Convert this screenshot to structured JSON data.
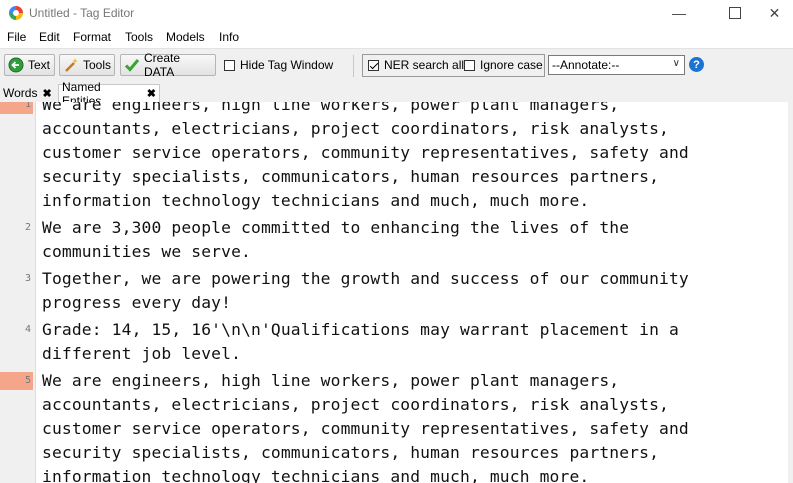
{
  "window": {
    "title": "Untitled - Tag Editor"
  },
  "menu": [
    "File",
    "Edit",
    "Format",
    "Tools",
    "Models",
    "Info"
  ],
  "toolbar": {
    "text_label": "Text",
    "tools_label": "Tools",
    "create_data_label": "Create DATA",
    "hide_tag_window_label": "Hide Tag Window",
    "ner_search_all_label": "NER search all",
    "ignore_case_label": "Ignore case",
    "annotate_value": "--Annotate:--",
    "help_label": "?"
  },
  "tabs": [
    {
      "label": "Words"
    },
    {
      "label": "Named Entities"
    }
  ],
  "lines": [
    {
      "number": "1",
      "highlight": true,
      "rows": [
        "We are engineers, high line workers, power plant managers,",
        "accountants, electricians, project coordinators, risk analysts,",
        "customer service operators, community representatives, safety and",
        "security specialists, communicators, human resources partners,",
        "information technology technicians and much, much more."
      ]
    },
    {
      "number": "2",
      "highlight": false,
      "rows": [
        "We are 3,300 people committed to enhancing the lives of the",
        "communities we serve."
      ]
    },
    {
      "number": "3",
      "highlight": false,
      "rows": [
        "Together, we are powering the growth and success of our community",
        "progress every day!"
      ]
    },
    {
      "number": "4",
      "highlight": false,
      "rows": [
        "Grade: 14, 15, 16'\\n\\n'Qualifications may warrant placement in a",
        "different job level."
      ]
    },
    {
      "number": "5",
      "highlight": true,
      "rows": [
        "We are engineers, high line workers, power plant managers,",
        "accountants, electricians, project coordinators, risk analysts,",
        "customer service operators, community representatives, safety and",
        "security specialists, communicators, human resources partners,",
        "information technology technicians and much, much more."
      ]
    }
  ],
  "colors": {
    "line_highlight": "#f4a58a",
    "help_icon": "#1d73d1"
  }
}
